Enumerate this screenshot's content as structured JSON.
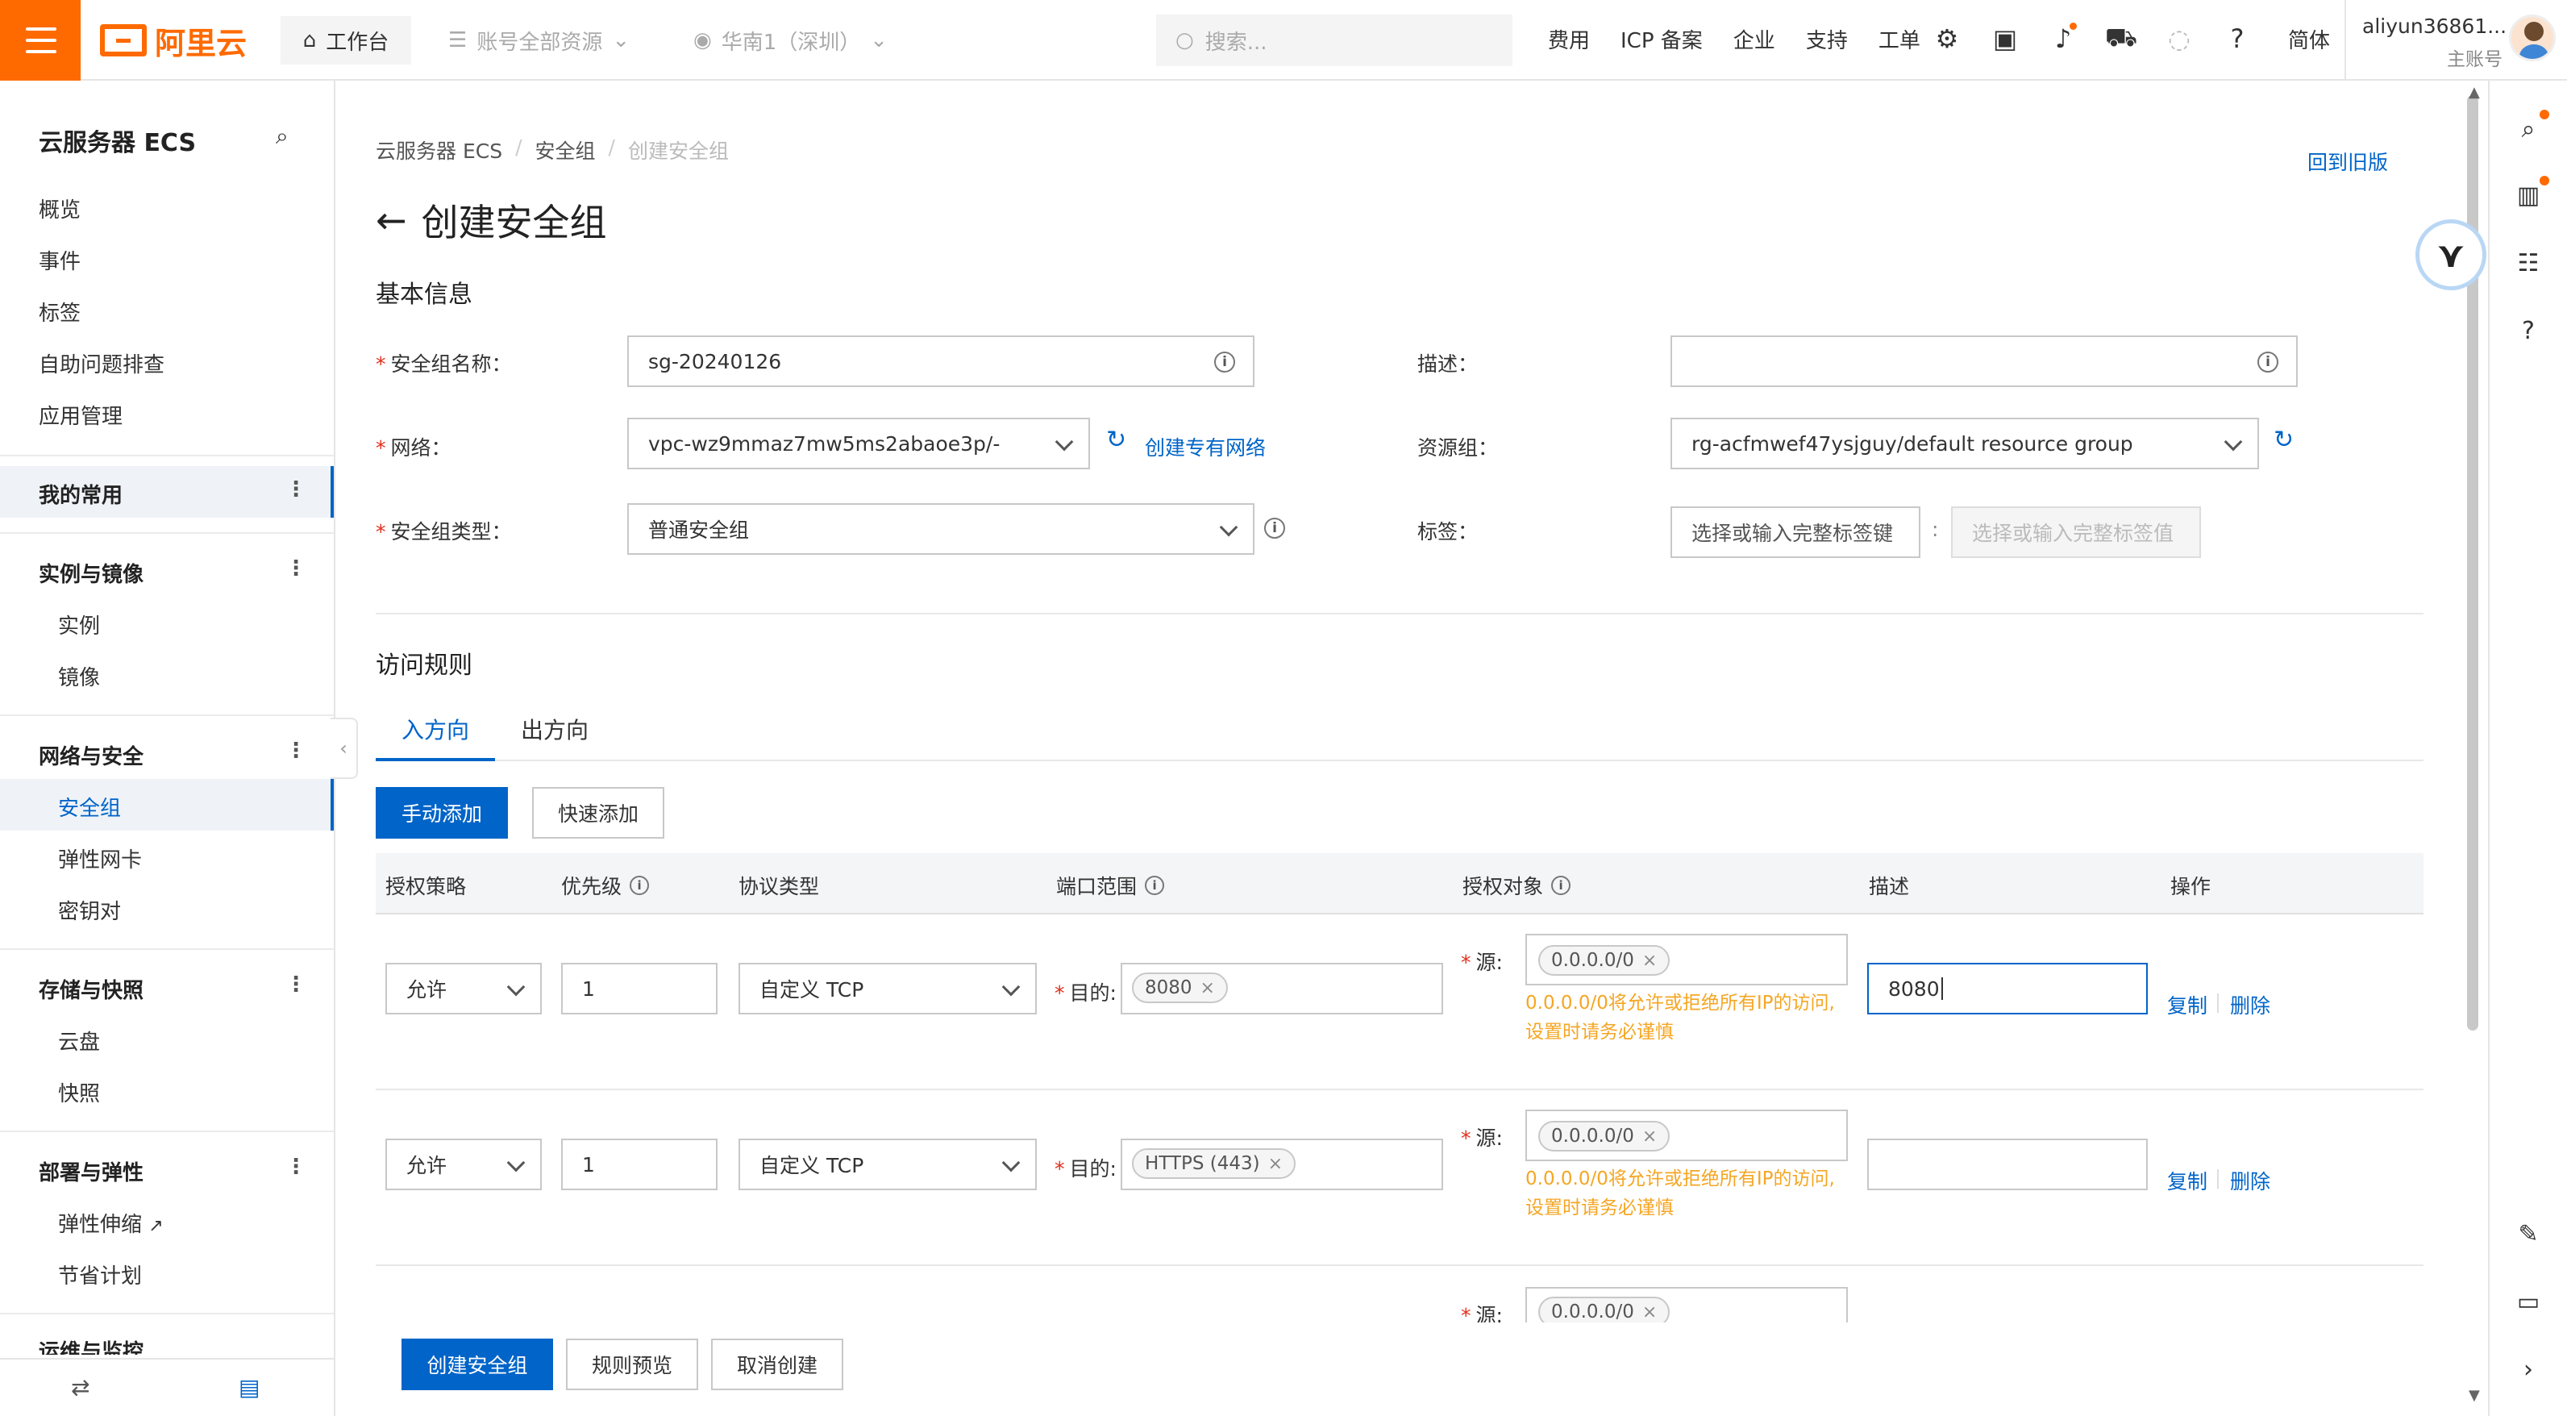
{
  "topbar": {
    "logo_text": "阿里云",
    "workbench": "工作台",
    "resources": "账号全部资源",
    "region": "华南1（深圳）",
    "search_placeholder": "搜索...",
    "links": [
      "费用",
      "ICP 备案",
      "企业",
      "支持",
      "工单"
    ],
    "lang": "简体",
    "username": "aliyun36861...",
    "account_type": "主账号"
  },
  "sidebar": {
    "title": "云服务器 ECS",
    "top_items": [
      "概览",
      "事件",
      "标签",
      "自助问题排查",
      "应用管理"
    ],
    "favorites": "我的常用",
    "groups": [
      {
        "title": "实例与镜像",
        "items": [
          "实例",
          "镜像"
        ]
      },
      {
        "title": "网络与安全",
        "items": [
          "安全组",
          "弹性网卡",
          "密钥对"
        ]
      },
      {
        "title": "存储与快照",
        "items": [
          "云盘",
          "快照"
        ]
      },
      {
        "title": "部署与弹性",
        "items": [
          "弹性伸缩",
          "节省计划"
        ]
      },
      {
        "title": "运维与监控",
        "items": []
      }
    ],
    "active_item": "安全组"
  },
  "breadcrumb": [
    "云服务器 ECS",
    "安全组",
    "创建安全组"
  ],
  "back_old_version": "回到旧版",
  "page_title": "创建安全组",
  "basic": {
    "section_title": "基本信息",
    "name_label": "安全组名称：",
    "name_value": "sg-20240126",
    "desc_label": "描述：",
    "desc_value": "",
    "network_label": "网络：",
    "network_value": "vpc-wz9mmaz7mw5ms2abaoe3p/-",
    "create_vpc": "创建专有网络",
    "rg_label": "资源组：",
    "rg_value": "rg-acfmwef47ysjguy/default resource group",
    "type_label": "安全组类型：",
    "type_value": "普通安全组",
    "tag_label": "标签：",
    "tag_key_placeholder": "选择或输入完整标签键",
    "tag_value_placeholder": "选择或输入完整标签值",
    "tag_sep": ":"
  },
  "rules": {
    "section_title": "访问规则",
    "tabs": [
      "入方向",
      "出方向"
    ],
    "manual_add": "手动添加",
    "quick_add": "快速添加",
    "columns": [
      "授权策略",
      "优先级",
      "协议类型",
      "端口范围",
      "授权对象",
      "描述",
      "操作"
    ],
    "dest_label": "目的:",
    "src_label": "源:",
    "warning_line1": "0.0.0.0/0将允许或拒绝所有IP的访问,",
    "warning_line2": "设置时请务必谨慎",
    "copy": "复制",
    "delete": "删除",
    "rows": [
      {
        "policy": "允许",
        "priority": "1",
        "protocol": "自定义 TCP",
        "port": "8080",
        "source": "0.0.0.0/0",
        "desc": "8080"
      },
      {
        "policy": "允许",
        "priority": "1",
        "protocol": "自定义 TCP",
        "port": "HTTPS (443)",
        "source": "0.0.0.0/0",
        "desc": ""
      },
      {
        "source": "0.0.0.0/0"
      }
    ]
  },
  "footer": {
    "create": "创建安全组",
    "preview": "规则预览",
    "cancel": "取消创建"
  },
  "colors": {
    "brand": "#ff6a00",
    "primary": "#0064c8",
    "warning": "#f5a623",
    "required": "#e0301e"
  }
}
